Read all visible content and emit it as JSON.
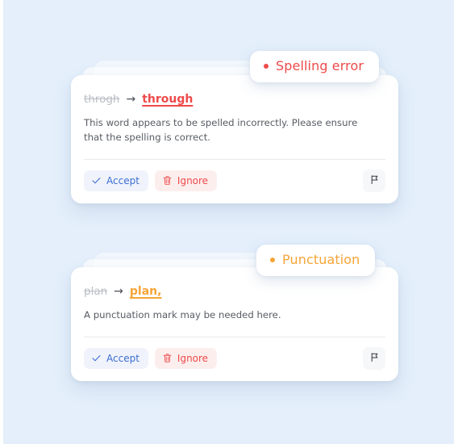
{
  "theme": {
    "page_background": "#e4effb",
    "card_background": "#ffffff",
    "spelling_color": "#ee4a4a",
    "punctuation_color": "#f6a436",
    "accept_color": "#3c6ed2",
    "accept_background": "#f0f3fb",
    "ignore_color": "#ee4a4a",
    "ignore_background": "#fdeeee",
    "flag_background": "#f6f7f9",
    "old_word_color": "#b9bdc4",
    "description_color": "#575c63",
    "divider_color": "#e9eaee"
  },
  "cards": [
    {
      "badge": {
        "label": "Spelling error",
        "dot": "bullet-dot",
        "color": "#ee4a4a"
      },
      "correction": {
        "original": "throgh",
        "arrow": "→",
        "suggestion": "through",
        "color": "#ee4a4a"
      },
      "description": "This word appears to be spelled incorrectly. Please ensure that the spelling is correct.",
      "actions": {
        "accept_label": "Accept",
        "accept_icon": "check-icon",
        "ignore_label": "Ignore",
        "ignore_icon": "trash-icon",
        "flag_icon": "flag-icon"
      }
    },
    {
      "badge": {
        "label": "Punctuation",
        "dot": "bullet-dot",
        "color": "#f6a436"
      },
      "correction": {
        "original": "plan",
        "arrow": "→",
        "suggestion": "plan,",
        "color": "#f6a436"
      },
      "description": "A punctuation mark may be needed here.",
      "actions": {
        "accept_label": "Accept",
        "accept_icon": "check-icon",
        "ignore_label": "Ignore",
        "ignore_icon": "trash-icon",
        "flag_icon": "flag-icon"
      }
    }
  ]
}
